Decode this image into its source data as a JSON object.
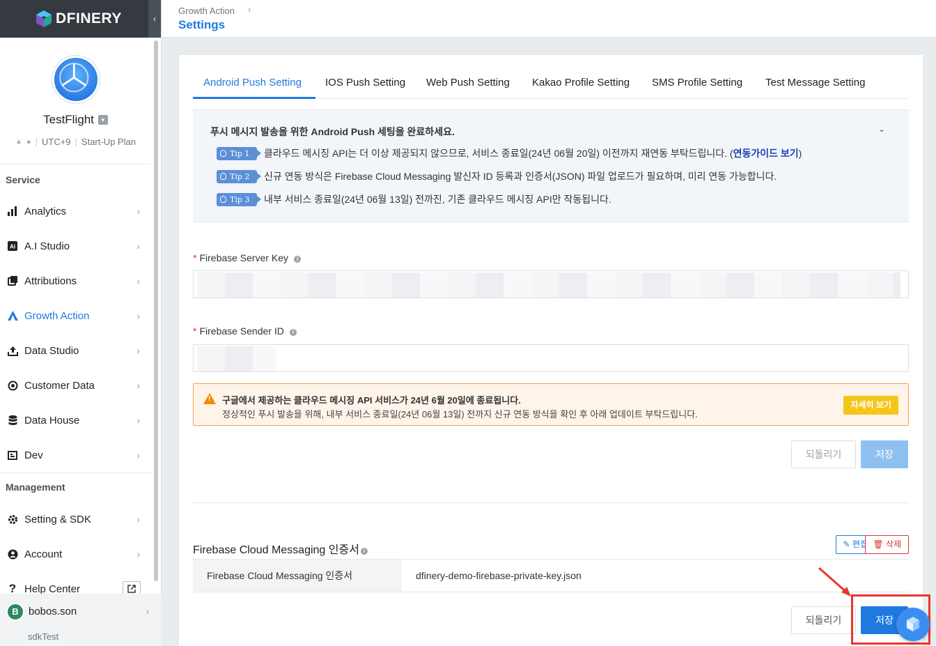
{
  "brand": {
    "name": "DFINERY"
  },
  "app": {
    "name": "TestFlight",
    "timezone": "UTC+9",
    "plan": "Start-Up Plan"
  },
  "sidebar": {
    "service_label": "Service",
    "service_items": [
      {
        "label": "Analytics",
        "icon": "bar-chart-icon"
      },
      {
        "label": "A.I Studio",
        "icon": "ai-icon"
      },
      {
        "label": "Attributions",
        "icon": "attribution-icon"
      },
      {
        "label": "Growth Action",
        "icon": "growth-icon"
      },
      {
        "label": "Data Studio",
        "icon": "upload-icon"
      },
      {
        "label": "Customer Data",
        "icon": "target-icon"
      },
      {
        "label": "Data House",
        "icon": "database-icon"
      },
      {
        "label": "Dev",
        "icon": "dev-icon"
      }
    ],
    "management_label": "Management",
    "management_items": [
      {
        "label": "Setting & SDK",
        "icon": "gear-icon"
      },
      {
        "label": "Account",
        "icon": "person-icon"
      },
      {
        "label": "Help Center",
        "icon": "question-icon"
      }
    ],
    "user": {
      "initial": "B",
      "name": "bobos.son",
      "workspace": "sdkTest"
    }
  },
  "header": {
    "breadcrumb": "Growth Action",
    "title": "Settings"
  },
  "tabs": [
    {
      "label": "Android Push Setting",
      "active": true
    },
    {
      "label": "IOS Push Setting"
    },
    {
      "label": "Web Push Setting"
    },
    {
      "label": "Kakao Profile Setting"
    },
    {
      "label": "SMS Profile Setting"
    },
    {
      "label": "Test Message Setting"
    }
  ],
  "info": {
    "title": "푸시 메시지 발송을 위한 Android Push 세팅을 완료하세요.",
    "tips": [
      {
        "badge": "Tip 1",
        "text": "클라우드 메시징 API는 더 이상 제공되지 않으므로, 서비스 종료일(24년 06월 20일) 이전까지 재연동 부탁드립니다. (",
        "link": "연동가이드 보기",
        "suffix": ")"
      },
      {
        "badge": "Tip 2",
        "text": "신규 연동 방식은 Firebase Cloud Messaging 발신자 ID 등록과 인증서(JSON) 파일 업로드가 필요하며, 미리 연동 가능합니다."
      },
      {
        "badge": "Tip 3",
        "text": "내부 서비스 종료일(24년 06월 13일) 전까진, 기존 클라우드 메시징 API만 작동됩니다."
      }
    ]
  },
  "fields": {
    "server_key_label": "Firebase Server Key",
    "sender_id_label": "Firebase Sender ID"
  },
  "warning": {
    "title": "구글에서 제공하는 클라우드 메시징 API 서비스가 24년 6월 20일에 종료됩니다.",
    "text": "정상적인 푸시 발송을 위해, 내부 서비스 종료일(24년 06월 13일) 전까지 신규 연동 방식을 확인 후 아래 업데이트 부탁드립니다.",
    "button": "자세히 보기"
  },
  "actions": {
    "revert": "되돌리기",
    "save": "저장"
  },
  "certificate": {
    "section_title": "Firebase Cloud Messaging 인증서",
    "edit": "편집",
    "delete": "삭제",
    "row_label": "Firebase Cloud Messaging 인증서",
    "file_name": "dfinery-demo-firebase-private-key.json"
  },
  "colors": {
    "accent": "#1f7ae0",
    "highlight": "#e8372c",
    "warning_border": "#f0a04b"
  }
}
